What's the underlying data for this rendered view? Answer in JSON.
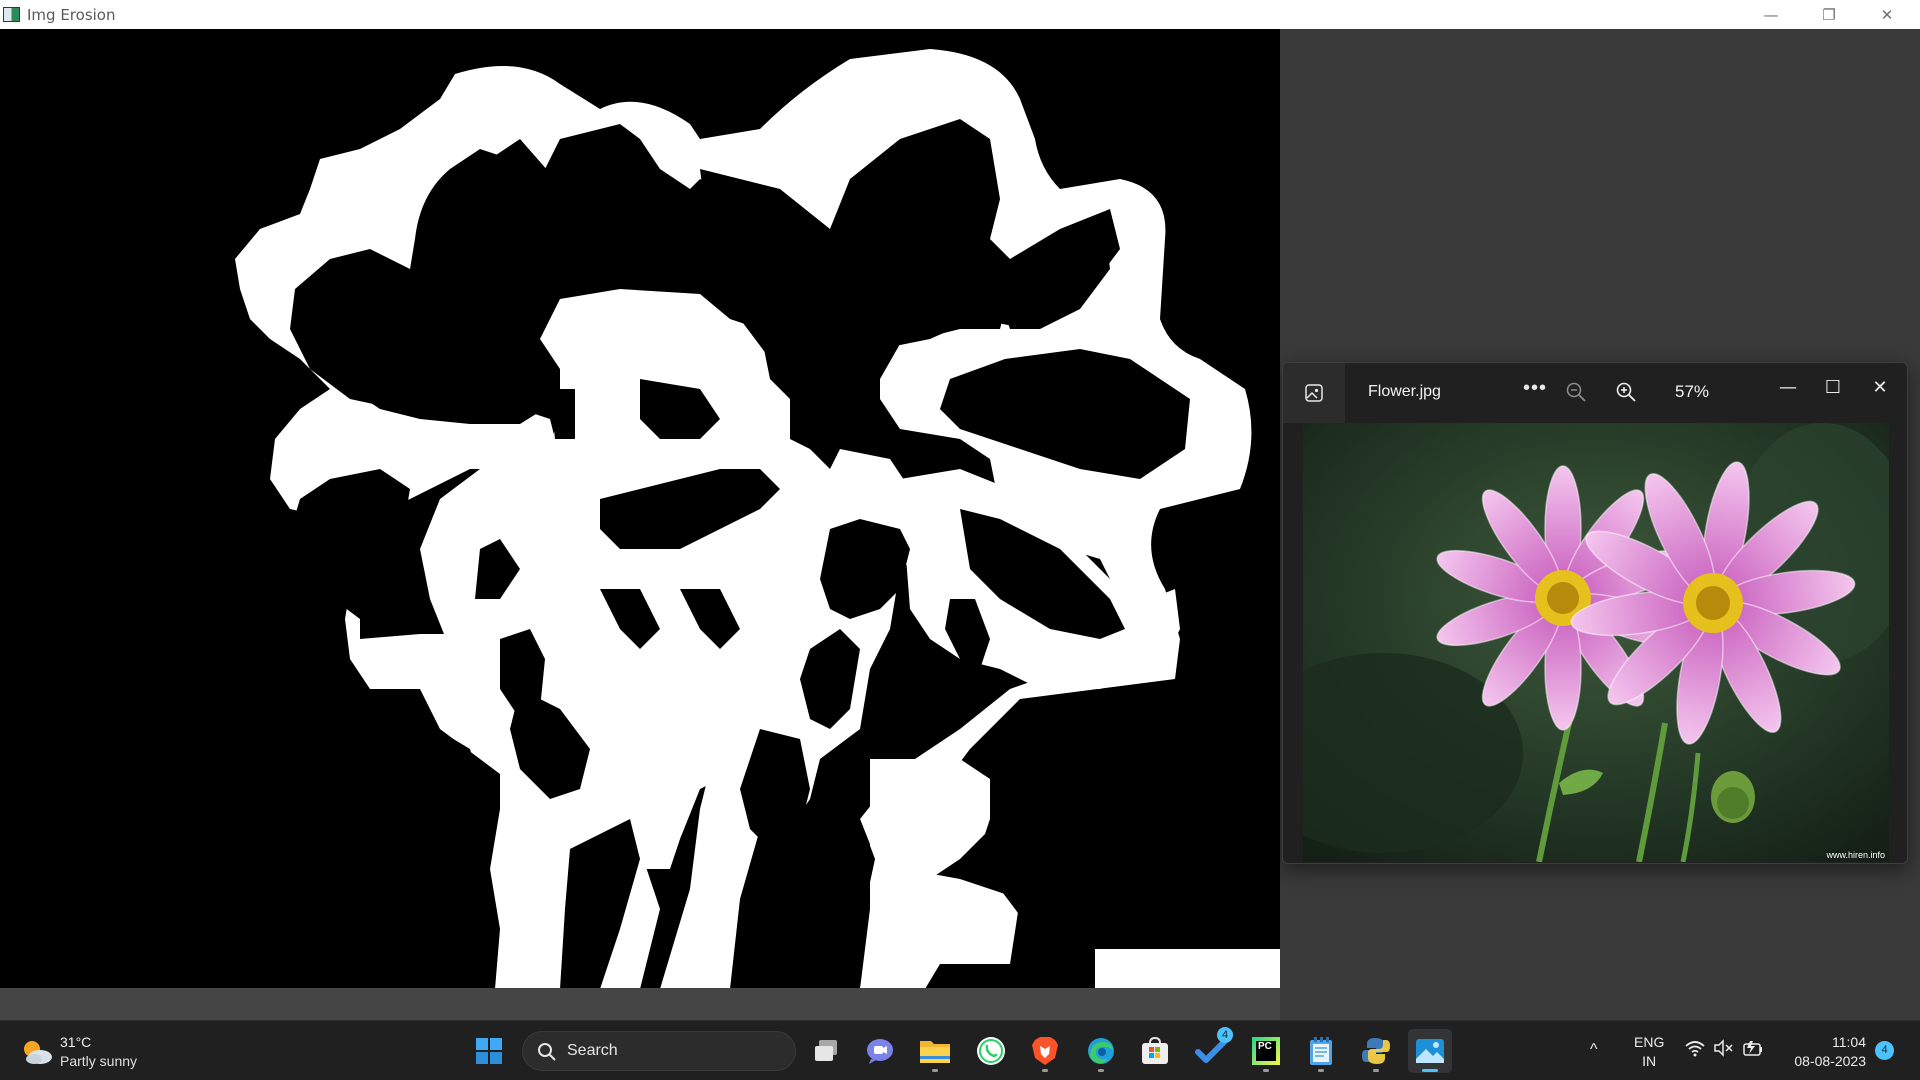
{
  "erosion_window": {
    "title": "Img Erosion",
    "controls": {
      "minimize": "—",
      "restore": "❐",
      "close": "✕"
    }
  },
  "photos_window": {
    "filename": "Flower.jpg",
    "more_label": "•••",
    "zoom_level": "57%",
    "watermark": "www.hiren.info",
    "controls": {
      "minimize": "—",
      "maximize": "☐",
      "close": "✕"
    },
    "icons": [
      "gallery-icon",
      "more-icon",
      "zoom-out-icon",
      "zoom-in-icon"
    ]
  },
  "taskbar": {
    "weather": {
      "temp": "31°C",
      "desc": "Partly sunny",
      "icon": "partly-sunny-icon"
    },
    "search": {
      "label": "Search"
    },
    "apps": [
      {
        "name": "start",
        "icon": "windows-logo-icon"
      },
      {
        "name": "task-view",
        "icon": "task-view-icon"
      },
      {
        "name": "teams-chat",
        "icon": "chat-icon"
      },
      {
        "name": "file-explorer",
        "icon": "folder-icon"
      },
      {
        "name": "whatsapp",
        "icon": "whatsapp-icon"
      },
      {
        "name": "brave",
        "icon": "brave-icon"
      },
      {
        "name": "edge",
        "icon": "edge-icon"
      },
      {
        "name": "microsoft-store",
        "icon": "store-icon"
      },
      {
        "name": "todo",
        "icon": "todo-icon",
        "badge": "4"
      },
      {
        "name": "pycharm",
        "icon": "pycharm-icon",
        "label": "PC"
      },
      {
        "name": "notepad",
        "icon": "notepad-icon"
      },
      {
        "name": "python",
        "icon": "python-icon"
      },
      {
        "name": "photos",
        "icon": "photos-icon",
        "active": true
      }
    ],
    "tray": {
      "chevron": "^",
      "lang_line1": "ENG",
      "lang_line2": "IN",
      "icons": [
        "wifi-icon",
        "mute-speaker-icon",
        "battery-charging-icon"
      ],
      "time": "11:04",
      "date": "08-08-2023",
      "notification_count": "4"
    }
  },
  "colors": {
    "taskbar_bg": "#202020",
    "accent": "#4cc2ff",
    "desktop_bg": "#3a3a3a",
    "erosion_fg": "#ffffff",
    "erosion_bg": "#000000"
  }
}
